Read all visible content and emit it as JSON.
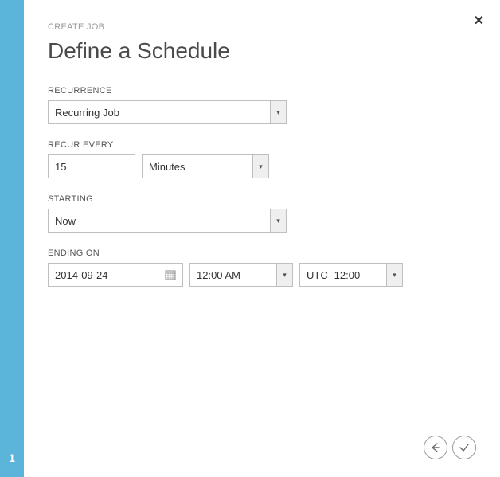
{
  "sidebar": {
    "step": "1"
  },
  "header": {
    "breadcrumb": "CREATE JOB",
    "title": "Define a Schedule"
  },
  "fields": {
    "recurrence": {
      "label": "RECURRENCE",
      "value": "Recurring Job"
    },
    "recurEvery": {
      "label": "RECUR EVERY",
      "interval": "15",
      "unit": "Minutes"
    },
    "starting": {
      "label": "STARTING",
      "value": "Now"
    },
    "endingOn": {
      "label": "ENDING ON",
      "date": "2014-09-24",
      "time": "12:00 AM",
      "timezone": "UTC -12:00"
    }
  },
  "close": "✕"
}
